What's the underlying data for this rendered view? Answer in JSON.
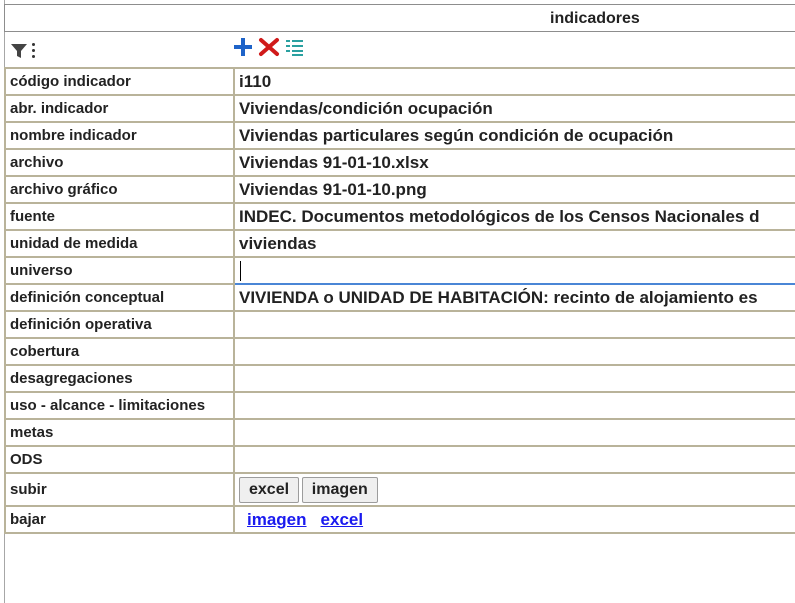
{
  "header": {
    "title": "indicadores"
  },
  "toolbar": {
    "icons": [
      "filter-icon",
      "kebab-menu-icon",
      "add-icon",
      "delete-icon",
      "list-icon"
    ],
    "colors": {
      "add": "#1e63c8",
      "delete": "#d01a1a",
      "list": "#2aa0a0"
    }
  },
  "fields": [
    {
      "label": "código indicador",
      "value": "i110"
    },
    {
      "label": "abr. indicador",
      "value": "Viviendas/condición ocupación"
    },
    {
      "label": "nombre indicador",
      "value": "Viviendas particulares según condición de ocupación"
    },
    {
      "label": "archivo",
      "value": "Viviendas 91-01-10.xlsx"
    },
    {
      "label": "archivo gráfico",
      "value": "Viviendas 91-01-10.png"
    },
    {
      "label": "fuente",
      "value": "INDEC. Documentos metodológicos de los Censos Nacionales d"
    },
    {
      "label": "unidad de medida",
      "value": "viviendas"
    },
    {
      "label": "universo",
      "value": ""
    },
    {
      "label": "definición conceptual",
      "value": "VIVIENDA o UNIDAD DE HABITACIÓN: recinto de alojamiento es"
    },
    {
      "label": "definición operativa",
      "value": ""
    },
    {
      "label": "cobertura",
      "value": ""
    },
    {
      "label": "desagregaciones",
      "value": ""
    },
    {
      "label": "uso - alcance - limitaciones",
      "value": ""
    },
    {
      "label": "metas",
      "value": ""
    },
    {
      "label": "ODS",
      "value": ""
    }
  ],
  "upload": {
    "label": "subir",
    "buttons": [
      "excel",
      "imagen"
    ]
  },
  "download": {
    "label": "bajar",
    "links": [
      "imagen",
      "excel"
    ]
  }
}
